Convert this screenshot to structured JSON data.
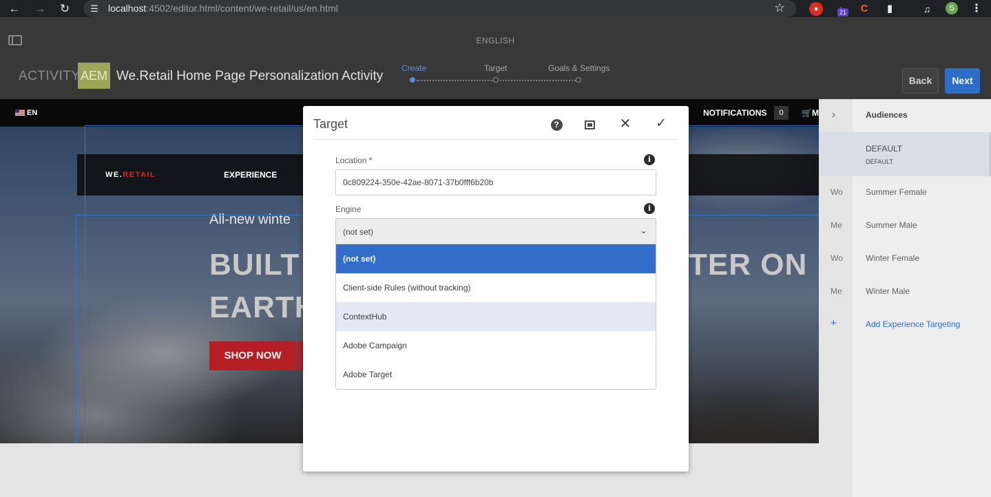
{
  "browser": {
    "url_host": "localhost",
    "url_path": ":4502/editor.html/content/we-retail/us/en.html",
    "extension_badge": "21",
    "profile_initial": "S",
    "icons": [
      "back-icon",
      "forward-icon",
      "reload-icon",
      "site-info-icon",
      "star-icon",
      "extensions-icon",
      "media-icon",
      "menu-icon"
    ]
  },
  "header": {
    "language": "ENGLISH",
    "activity_label": "ACTIVITY:",
    "badge": "AEM",
    "activity_title": "We.Retail Home Page Personalization Activity",
    "steps": [
      {
        "label": "Create",
        "active": true
      },
      {
        "label": "Target",
        "active": false
      },
      {
        "label": "Goals & Settings",
        "active": false
      }
    ],
    "back_label": "Back",
    "next_label": "Next",
    "accent_color": "#2d6ec9"
  },
  "site": {
    "lang_label": "EN",
    "notifications_label": "NOTIFICATIONS",
    "notifications_count": "0",
    "cart_label": "M",
    "logo_white": "WE.",
    "logo_red": "RETAIL",
    "menu_item": "EXPERIENCE",
    "hero_subtitle": "All-new winte",
    "hero_title_line1": "BUILT",
    "hero_title_line2": "EARTH",
    "hero_title_right": "TER ON",
    "shop_button": "SHOP NOW"
  },
  "modal": {
    "title": "Target",
    "location_label": "Location *",
    "location_value": "0c809224-350e-42ae-8071-37b0fff6b20b",
    "engine_label": "Engine",
    "engine_value": "(not set)",
    "options": [
      {
        "label": "(not set)",
        "state": "selected"
      },
      {
        "label": "Client-side Rules (without tracking)",
        "state": "normal"
      },
      {
        "label": "ContextHub",
        "state": "hover"
      },
      {
        "label": "Adobe Campaign",
        "state": "normal"
      },
      {
        "label": "Adobe Target",
        "state": "normal"
      }
    ]
  },
  "audiences": {
    "header": "Audiences",
    "default_label": "DEFAULT",
    "default_sub": "DEFAULT",
    "items": [
      {
        "abbr": "Wo",
        "name": "Summer Female"
      },
      {
        "abbr": "Me",
        "name": "Summer Male"
      },
      {
        "abbr": "Wo",
        "name": "Winter Female"
      },
      {
        "abbr": "Me",
        "name": "Winter Male"
      }
    ],
    "add_label": "Add Experience Targeting"
  }
}
